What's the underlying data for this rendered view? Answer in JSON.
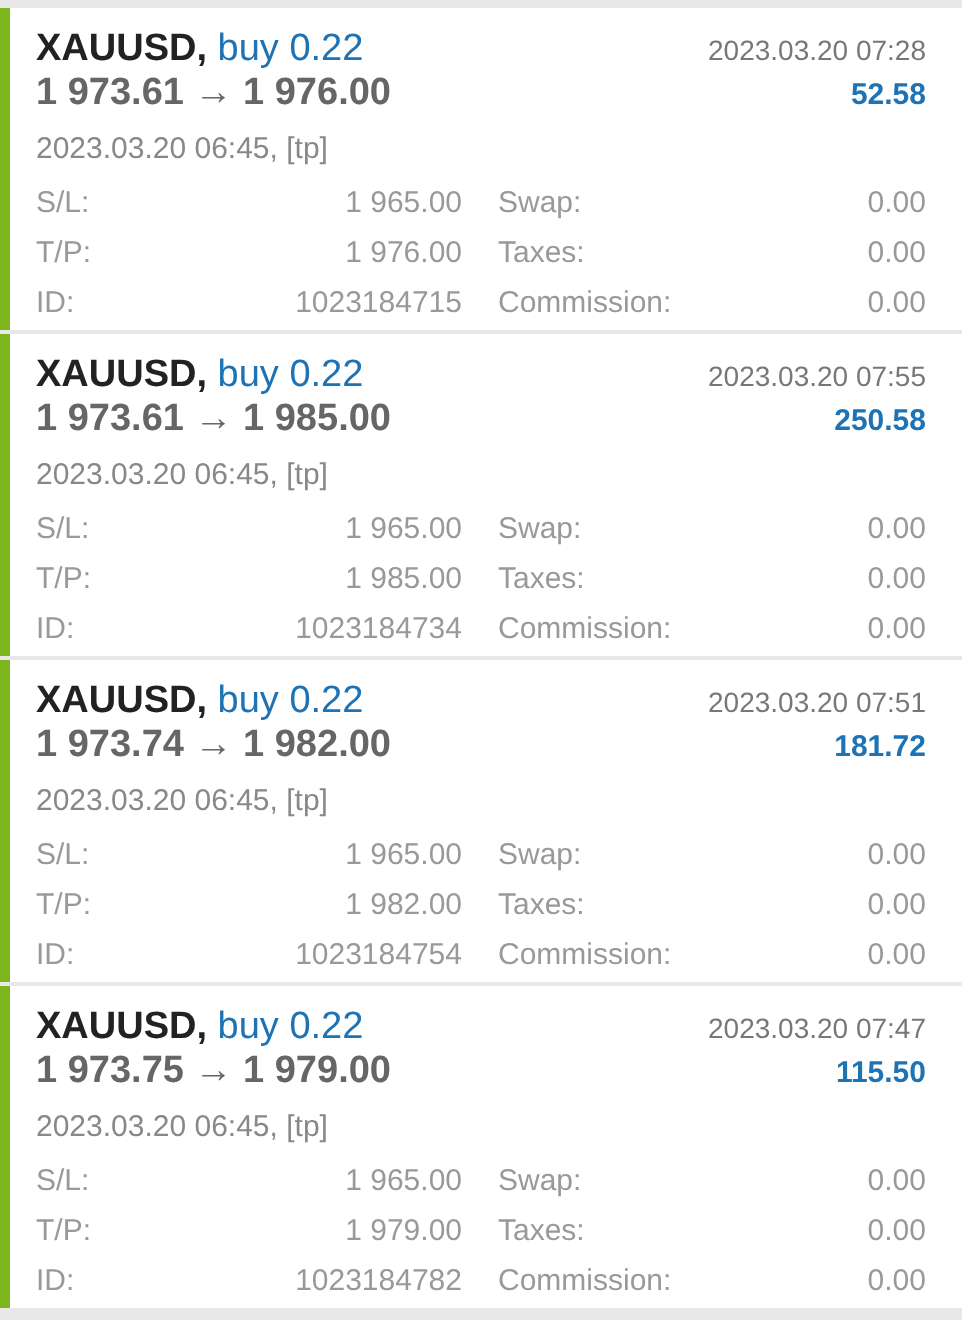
{
  "deals": [
    {
      "symbol": "XAUUSD,",
      "side": "buy 0.22",
      "prices": "1 973.61 → 1 976.00",
      "close_time": "2023.03.20 07:28",
      "profit": "52.58",
      "open_info": "2023.03.20 06:45, [tp]",
      "sl_label": "S/L:",
      "sl": "1 965.00",
      "tp_label": "T/P:",
      "tp": "1 976.00",
      "id_label": "ID:",
      "id": "1023184715",
      "swap_label": "Swap:",
      "swap": "0.00",
      "taxes_label": "Taxes:",
      "taxes": "0.00",
      "commission_label": "Commission:",
      "commission": "0.00"
    },
    {
      "symbol": "XAUUSD,",
      "side": "buy 0.22",
      "prices": "1 973.61 → 1 985.00",
      "close_time": "2023.03.20 07:55",
      "profit": "250.58",
      "open_info": "2023.03.20 06:45, [tp]",
      "sl_label": "S/L:",
      "sl": "1 965.00",
      "tp_label": "T/P:",
      "tp": "1 985.00",
      "id_label": "ID:",
      "id": "1023184734",
      "swap_label": "Swap:",
      "swap": "0.00",
      "taxes_label": "Taxes:",
      "taxes": "0.00",
      "commission_label": "Commission:",
      "commission": "0.00"
    },
    {
      "symbol": "XAUUSD,",
      "side": "buy 0.22",
      "prices": "1 973.74 → 1 982.00",
      "close_time": "2023.03.20 07:51",
      "profit": "181.72",
      "open_info": "2023.03.20 06:45, [tp]",
      "sl_label": "S/L:",
      "sl": "1 965.00",
      "tp_label": "T/P:",
      "tp": "1 982.00",
      "id_label": "ID:",
      "id": "1023184754",
      "swap_label": "Swap:",
      "swap": "0.00",
      "taxes_label": "Taxes:",
      "taxes": "0.00",
      "commission_label": "Commission:",
      "commission": "0.00"
    },
    {
      "symbol": "XAUUSD,",
      "side": "buy 0.22",
      "prices": "1 973.75 → 1 979.00",
      "close_time": "2023.03.20 07:47",
      "profit": "115.50",
      "open_info": "2023.03.20 06:45, [tp]",
      "sl_label": "S/L:",
      "sl": "1 965.00",
      "tp_label": "T/P:",
      "tp": "1 979.00",
      "id_label": "ID:",
      "id": "1023184782",
      "swap_label": "Swap:",
      "swap": "0.00",
      "taxes_label": "Taxes:",
      "taxes": "0.00",
      "commission_label": "Commission:",
      "commission": "0.00"
    }
  ]
}
